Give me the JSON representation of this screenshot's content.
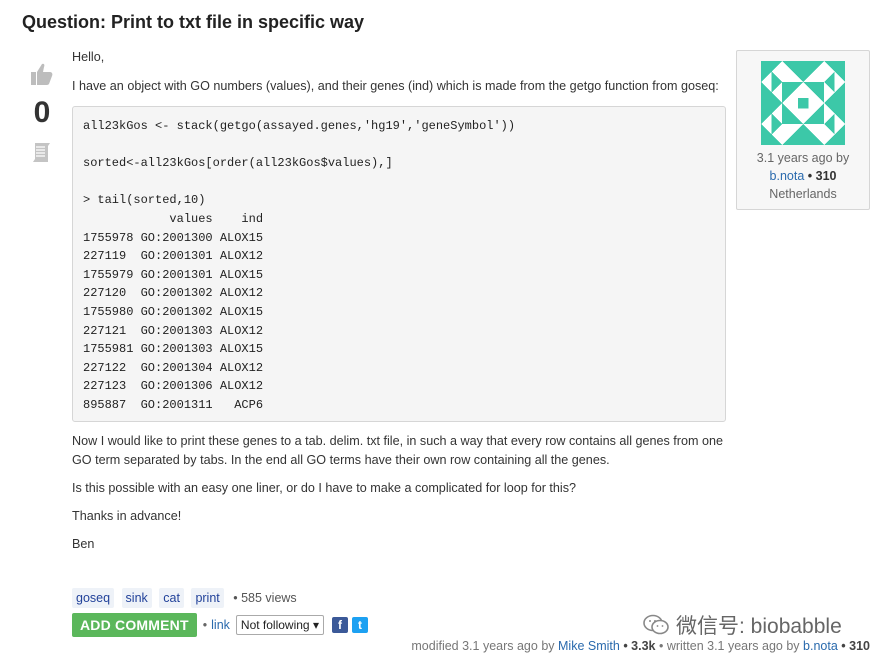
{
  "question": {
    "title": "Question: Print to txt file in specific way",
    "score": "0",
    "body": {
      "hello": "Hello,",
      "intro": "I have an object with GO numbers (values), and their genes (ind) which is made from the getgo function from goseq:",
      "code": "all23kGos <- stack(getgo(assayed.genes,'hg19','geneSymbol'))\n\nsorted<-all23kGos[order(all23kGos$values),]\n\n> tail(sorted,10)\n            values    ind\n1755978 GO:2001300 ALOX15\n227119  GO:2001301 ALOX12\n1755979 GO:2001301 ALOX15\n227120  GO:2001302 ALOX12\n1755980 GO:2001302 ALOX15\n227121  GO:2001303 ALOX12\n1755981 GO:2001303 ALOX15\n227122  GO:2001304 ALOX12\n227123  GO:2001306 ALOX12\n895887  GO:2001311   ACP6",
      "after": "Now I would like to print these genes to a tab. delim. txt file, in such a way that every row contains all genes from one GO term separated by tabs. In the end all GO terms have their own row containing all the genes.",
      "ask": "Is this possible with an easy one liner, or do I have to make a complicated for loop for this?",
      "thanks": "Thanks in advance!",
      "signoff": "Ben"
    },
    "tags": [
      "goseq",
      "sink",
      "cat",
      "print"
    ],
    "views": "• 585 views"
  },
  "user_card": {
    "time": "3.1 years ago by",
    "user": "b.nota",
    "rep": "• 310",
    "location": "Netherlands"
  },
  "actions": {
    "add_comment": "ADD COMMENT",
    "bullet": "•",
    "link": "link",
    "follow": "Not following",
    "facebook": "f",
    "twitter": "t"
  },
  "modified": {
    "prefix": "modified 3.1 years ago by",
    "editor": "Mike Smith",
    "editor_rep": "• 3.3k",
    "mid": "• written 3.1 years ago by",
    "author": "b.nota",
    "author_rep": "• 310"
  },
  "watermark": "微信号: biobabble",
  "colors": {
    "comment_button": "#5bb75b",
    "link": "#2a6aad",
    "identicon": "#3cc8a8"
  },
  "icons": [
    "thumbs-up-icon",
    "bookmark-icon",
    "facebook-icon",
    "twitter-icon",
    "chevron-down-icon",
    "wechat-icon"
  ]
}
